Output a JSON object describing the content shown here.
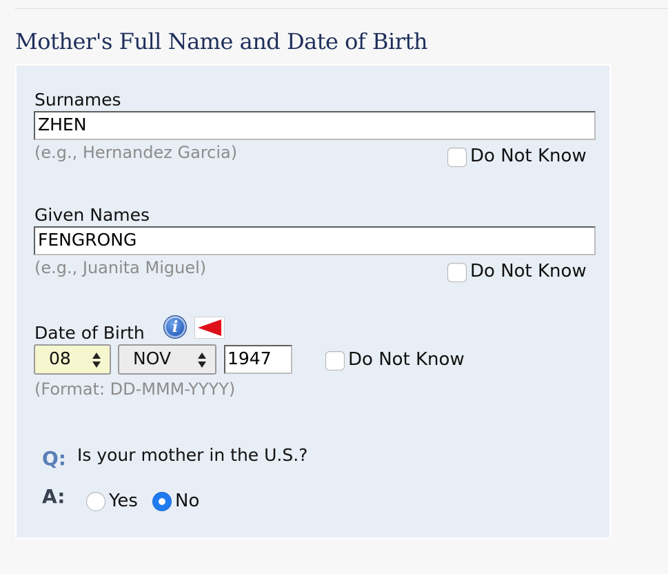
{
  "section": {
    "title": "Mother's Full Name and Date of Birth"
  },
  "surnames": {
    "label": "Surnames",
    "value": "ZHEN",
    "hint": "(e.g., Hernandez Garcia)",
    "do_not_know_label": "Do Not Know",
    "do_not_know_checked": false
  },
  "given_names": {
    "label": "Given Names",
    "value": "FENGRONG",
    "hint": "(e.g., Juanita Miguel)",
    "do_not_know_label": "Do Not Know",
    "do_not_know_checked": false
  },
  "date_of_birth": {
    "label": "Date of Birth",
    "day": "08",
    "month": "NOV",
    "year": "1947",
    "format_hint": "(Format: DD-MMM-YYYY)",
    "do_not_know_label": "Do Not Know",
    "do_not_know_checked": false,
    "icons": [
      "info-icon",
      "red-flag-icon"
    ]
  },
  "question": {
    "q_mark": "Q:",
    "text": "Is your mother in the U.S.?",
    "a_mark": "A:",
    "options": [
      {
        "label": "Yes",
        "selected": false
      },
      {
        "label": "No",
        "selected": true
      }
    ]
  },
  "colors": {
    "title": "#1f2f5c",
    "panel_background": "#e8eef5",
    "page_background": "#f7f7f7",
    "day_select_background": "#f6f6cf",
    "radio_selected": "#1f7bf0",
    "flag": "#e0101a"
  }
}
